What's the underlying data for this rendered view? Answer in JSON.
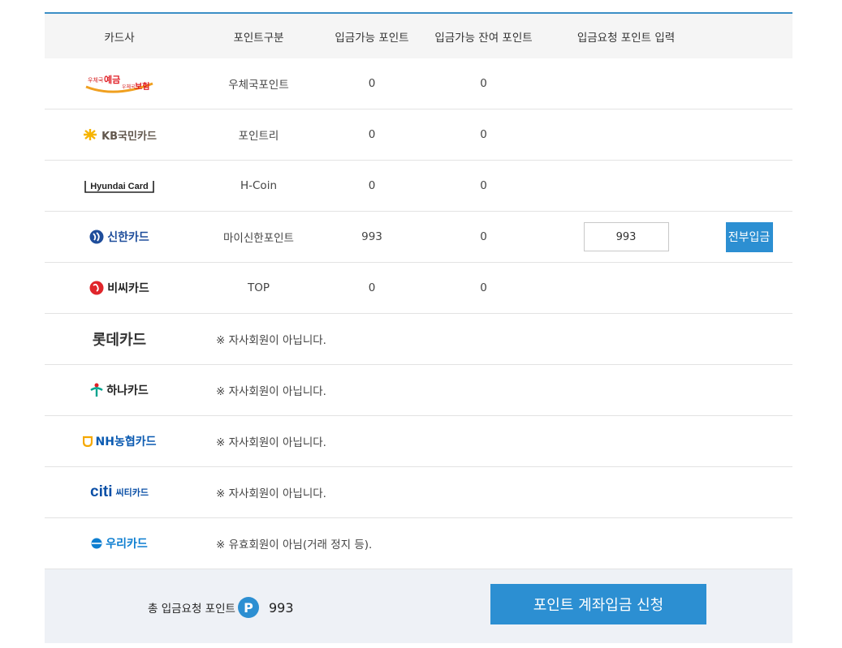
{
  "header": {
    "col1": "카드사",
    "col2": "포인트구분",
    "col3": "입금가능 포인트",
    "col4": "입금가능 잔여 포인트",
    "col5": "입금요청 포인트 입력"
  },
  "cards": [
    {
      "logo_text": "우체국예금 우체국보험",
      "point_type": "우체국포인트",
      "available": "0",
      "remaining": "0"
    },
    {
      "logo_text": "KB국민카드",
      "point_type": "포인트리",
      "available": "0",
      "remaining": "0"
    },
    {
      "logo_text": "Hyundai Card",
      "point_type": "H-Coin",
      "available": "0",
      "remaining": "0"
    },
    {
      "logo_text": "신한카드",
      "point_type": "마이신한포인트",
      "available": "993",
      "remaining": "0",
      "request_value": "993",
      "all_button": "전부입금"
    },
    {
      "logo_text": "비씨카드",
      "point_type": "TOP",
      "available": "0",
      "remaining": "0"
    },
    {
      "logo_text": "롯데카드",
      "notice": "※ 자사회원이 아닙니다."
    },
    {
      "logo_text": "하나카드",
      "notice": "※ 자사회원이 아닙니다."
    },
    {
      "logo_text": "NH농협카드",
      "notice": "※ 자사회원이 아닙니다."
    },
    {
      "logo_text": "씨티카드",
      "logo_prefix": "citi",
      "notice": "※ 자사회원이 아닙니다."
    },
    {
      "logo_text": "우리카드",
      "notice": "※ 유효회원이 아님(거래 정지 등)."
    }
  ],
  "summary": {
    "label": "총 입금요청 포인트",
    "p_icon": "P",
    "total": "993",
    "submit_label": "포인트 계좌입금 신청"
  },
  "colors": {
    "accent": "#2c8fd2",
    "top_border": "#3c8fc6",
    "header_bg": "#f5f5f5",
    "summary_bg": "#eef1f6"
  }
}
